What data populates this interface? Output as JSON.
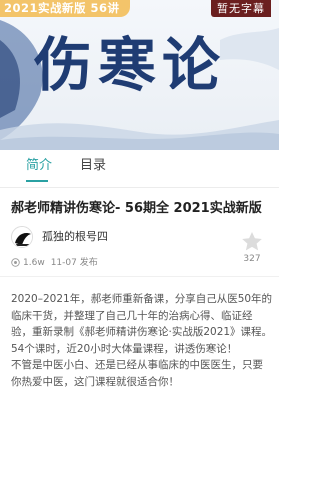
{
  "cover": {
    "badge": "2021实战新版 56讲",
    "subtitle_tag": "暂无字幕",
    "title": "伤寒论"
  },
  "tabs": [
    {
      "label": "简介",
      "active": true
    },
    {
      "label": "目录",
      "active": false
    }
  ],
  "course": {
    "title": "郝老师精讲伤寒论- 56期全 2021实战新版",
    "author": "孤独的根号四",
    "views": "1.6w",
    "date": "11-07 发布",
    "likes": "327"
  },
  "description": [
    "2020–2021年，郝老师重新备课，分享自己从医50年的临床干货，并整理了自己几十年的治病心得、临证经验，重新录制《郝老师精讲伤寒论·实战版2021》课程。",
    "54个课时，近20小时大体量课程，讲透伤寒论！",
    "不管是中医小白、还是已经从事临床的中医医生，只要你热爱中医，这门课程就很适合你！"
  ],
  "colors": {
    "accent": "#2aa1a3",
    "badge": "#f3c46a",
    "title_ink": "#1f3c73",
    "tag_bg": "#6b1f1f"
  },
  "icons": [
    "eye-icon",
    "star-icon",
    "avatar"
  ]
}
